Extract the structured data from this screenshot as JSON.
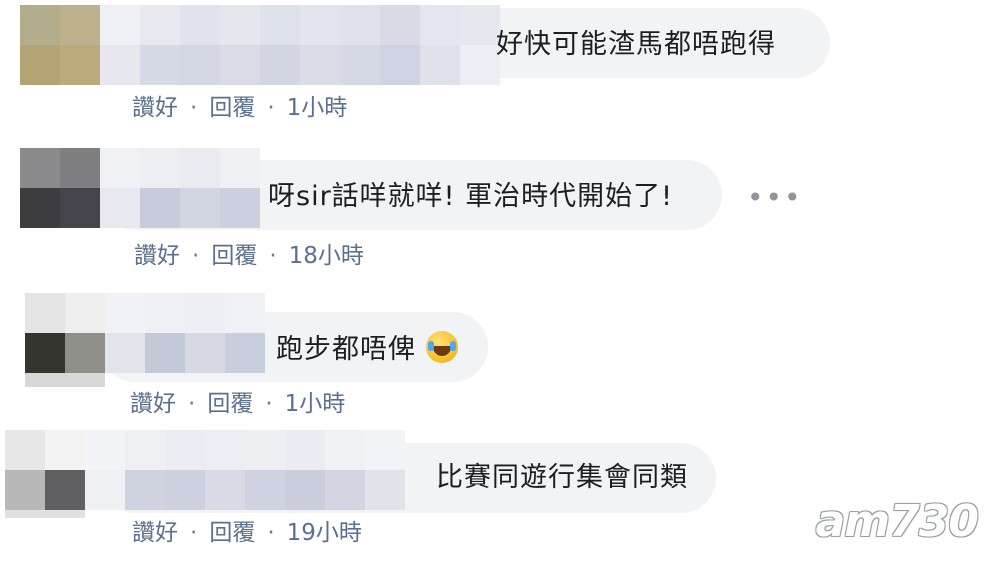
{
  "comments": [
    {
      "text": "好快可能渣馬都唔跑得",
      "like": "讚好",
      "reply": "回覆",
      "time": "1小時"
    },
    {
      "text": "呀sir話咩就咩! 軍治時代開始了!",
      "like": "讚好",
      "reply": "回覆",
      "time": "18小時",
      "more": "•••"
    },
    {
      "text": "跑步都唔俾",
      "emoji": "tears-of-joy-emoji",
      "like": "讚好",
      "reply": "回覆",
      "time": "1小時"
    },
    {
      "text": "比賽同遊行集會同類",
      "like": "讚好",
      "reply": "回覆",
      "time": "19小時"
    }
  ],
  "separator": "·",
  "watermark": "am730",
  "colors": {
    "bubble": "#f2f3f5",
    "action_text": "#5b6f8e",
    "text": "#1c1e21"
  }
}
